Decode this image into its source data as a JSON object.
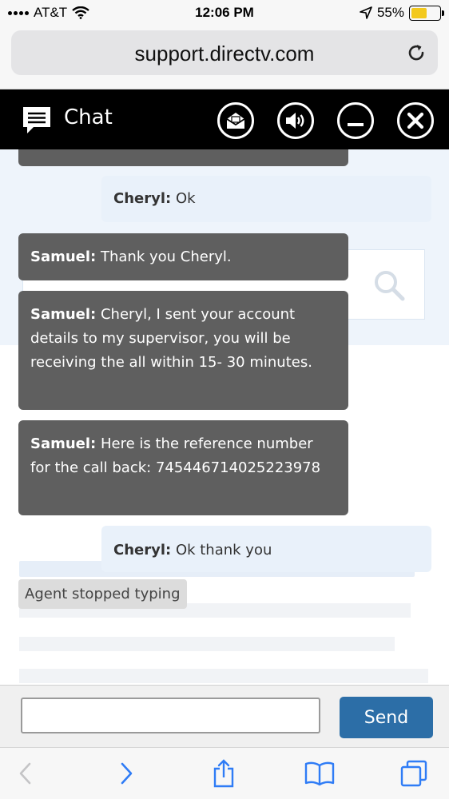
{
  "status_bar": {
    "carrier": "AT&T",
    "time": "12:06 PM",
    "battery_percent": "55%",
    "battery_level": 0.55,
    "icons": [
      "signal-icon",
      "wifi-icon",
      "location-arrow-icon",
      "battery-icon"
    ]
  },
  "browser": {
    "url": "support.directv.com"
  },
  "chat": {
    "title": "Chat",
    "header_buttons": [
      "email-transcript-icon",
      "sound-icon",
      "minimize-icon",
      "close-icon"
    ],
    "messages": [
      {
        "sender": "Cheryl:",
        "text": " Ok",
        "role": "user"
      },
      {
        "sender": "Samuel:",
        "text": " Thank you Cheryl.",
        "role": "agent"
      },
      {
        "sender": "Samuel:",
        "text": " Cheryl, I sent your account details to my supervisor, you will be receiving the all within 15- 30 minutes.",
        "role": "agent"
      },
      {
        "sender": "Samuel:",
        "text": " Here is the reference number for the call back: 745446714025223978",
        "role": "agent"
      },
      {
        "sender": "Cheryl:",
        "text": " Ok thank you",
        "role": "user"
      }
    ],
    "typing_status": "Agent stopped typing",
    "input_value": "",
    "send_label": "Send"
  },
  "colors": {
    "header_bg": "#000000",
    "agent_bubble": "#5f5f5f",
    "user_bubble": "#e9f1fa",
    "send_button": "#2c6ea7"
  }
}
